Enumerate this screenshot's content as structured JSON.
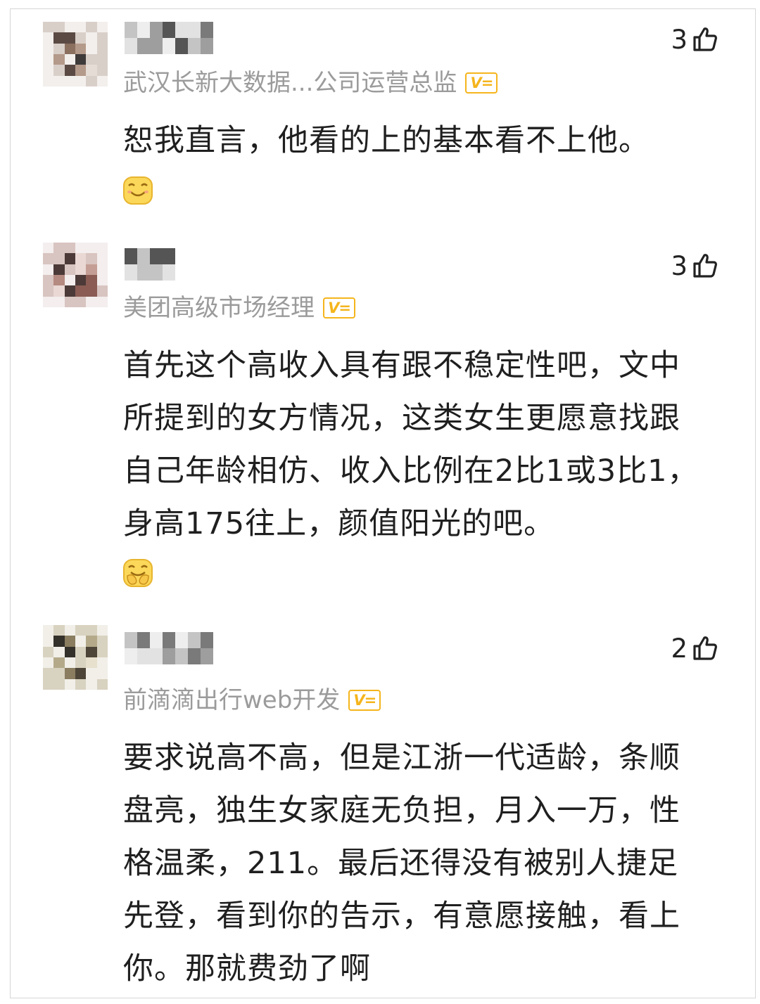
{
  "comments": [
    {
      "likes": "3",
      "title": "武汉长新大数据...公司运营总监",
      "badge": "V=",
      "text": "恕我直言，他看的上的基本看不上他。",
      "emoji": "grin-emoji"
    },
    {
      "likes": "3",
      "title": "美团高级市场经理",
      "badge": "V=",
      "text": "首先这个高收入具有跟不稳定性吧，文中所提到的女方情况，这类女生更愿意找跟自己年龄相仿、收入比例在2比1或3比1，身高175往上，颜值阳光的吧。",
      "emoji": "facepalm-laugh-emoji"
    },
    {
      "likes": "2",
      "title": "前滴滴出行web开发",
      "badge": "V=",
      "text": "要求说高不高，但是江浙一代适龄，条顺盘亮，独生女家庭无负担，月入一万，性格温柔，211。最后还得没有被别人捷足先登，看到你的告示，有意愿接触，看上你。那就费劲了啊"
    }
  ],
  "icons": {
    "like": "thumbs-up-outline-icon",
    "badge": "verified-v-badge-icon"
  },
  "colors": {
    "badge": "#f5b51c",
    "title_gray": "#9b9b9b",
    "text": "#1f1f1f",
    "emoji_yellow": "#fbd85a"
  }
}
